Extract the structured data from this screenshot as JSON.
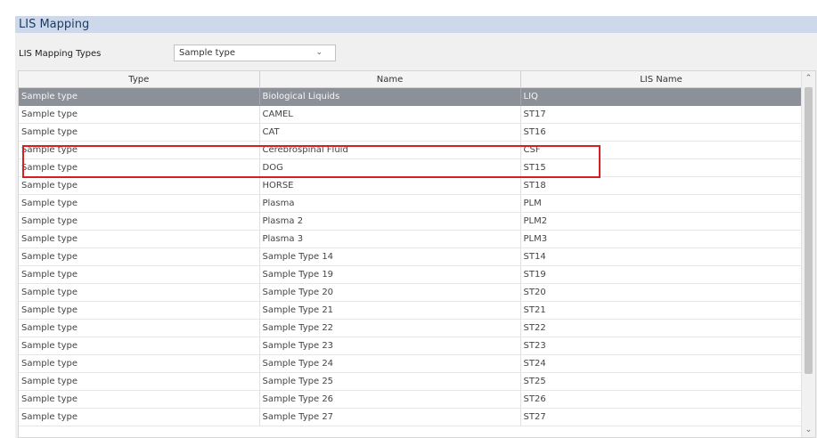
{
  "panel": {
    "title": "LIS Mapping"
  },
  "filter": {
    "label": "LIS Mapping Types",
    "selected": "Sample type"
  },
  "table": {
    "columns": [
      "Type",
      "Name",
      "LIS Name"
    ],
    "rows": [
      [
        "Sample type",
        "Biological Liquids",
        "LIQ"
      ],
      [
        "Sample type",
        "CAMEL",
        "ST17"
      ],
      [
        "Sample type",
        "CAT",
        "ST16"
      ],
      [
        "Sample type",
        "Cerebrospinal Fluid",
        "CSF"
      ],
      [
        "Sample type",
        "DOG",
        "ST15"
      ],
      [
        "Sample type",
        "HORSE",
        "ST18"
      ],
      [
        "Sample type",
        "Plasma",
        "PLM"
      ],
      [
        "Sample type",
        "Plasma 2",
        "PLM2"
      ],
      [
        "Sample type",
        "Plasma 3",
        "PLM3"
      ],
      [
        "Sample type",
        "Sample Type 14",
        "ST14"
      ],
      [
        "Sample type",
        "Sample Type 19",
        "ST19"
      ],
      [
        "Sample type",
        "Sample Type 20",
        "ST20"
      ],
      [
        "Sample type",
        "Sample Type 21",
        "ST21"
      ],
      [
        "Sample type",
        "Sample Type 22",
        "ST22"
      ],
      [
        "Sample type",
        "Sample Type 23",
        "ST23"
      ],
      [
        "Sample type",
        "Sample Type 24",
        "ST24"
      ],
      [
        "Sample type",
        "Sample Type 25",
        "ST25"
      ],
      [
        "Sample type",
        "Sample Type 26",
        "ST26"
      ],
      [
        "Sample type",
        "Sample Type 27",
        "ST27"
      ]
    ],
    "selected_row": 0
  },
  "icons": {
    "dropdown": "chevron-down-icon",
    "scroll_up": "chevron-up-icon",
    "scroll_down": "chevron-down-icon"
  },
  "colors": {
    "header_bg": "#cdd9ea",
    "selected_row_bg": "#8c9199",
    "highlight_border": "#d81e25"
  }
}
